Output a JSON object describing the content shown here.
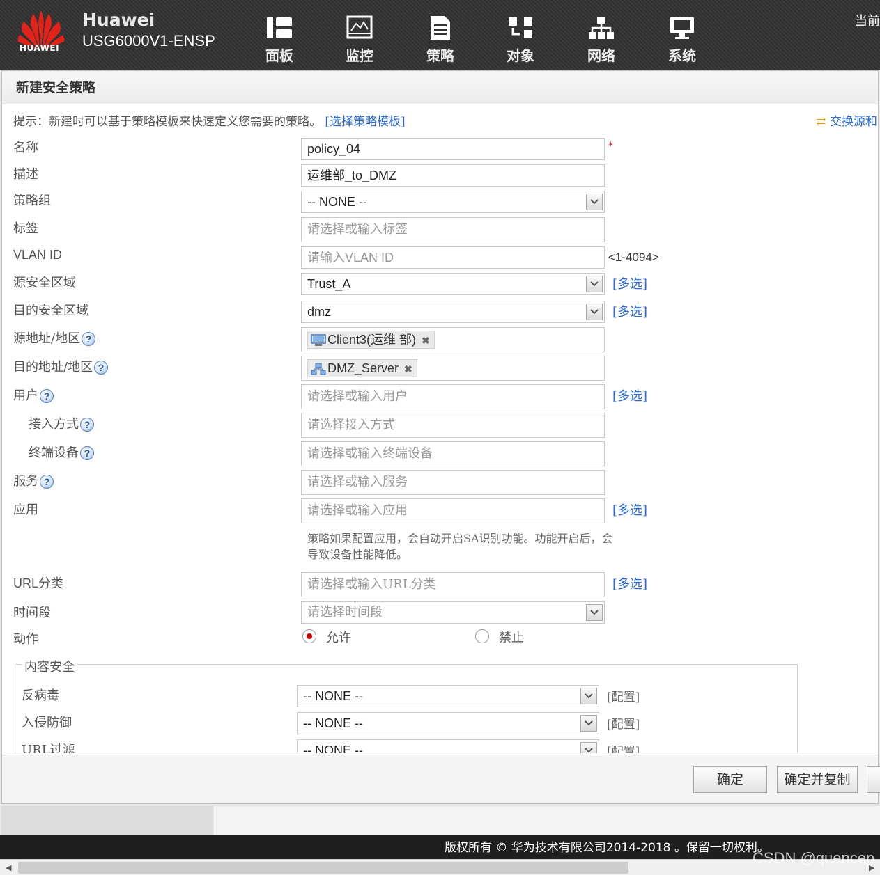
{
  "header": {
    "logo_text": "HUAWEI",
    "brand": "Huawei",
    "model": "USG6000V1-ENSP",
    "current_user_prefix": "当前",
    "nav": [
      {
        "label": "面板",
        "icon": "dashboard-icon"
      },
      {
        "label": "监控",
        "icon": "monitor-icon"
      },
      {
        "label": "策略",
        "icon": "policy-icon"
      },
      {
        "label": "对象",
        "icon": "object-icon"
      },
      {
        "label": "网络",
        "icon": "network-icon"
      },
      {
        "label": "系统",
        "icon": "system-icon"
      }
    ]
  },
  "dialog": {
    "title": "新建安全策略",
    "tip_text": "提示：新建时可以基于策略模板来快速定义您需要的策略。",
    "tip_link": "[选择策略模板]",
    "swap_link": "交换源和",
    "fields": {
      "name": {
        "label": "名称",
        "value": "policy_04"
      },
      "description": {
        "label": "描述",
        "value": "运维部_to_DMZ"
      },
      "policy_group": {
        "label": "策略组",
        "value": "-- NONE --"
      },
      "tag": {
        "label": "标签",
        "placeholder": "请选择或输入标签"
      },
      "vlan": {
        "label": "VLAN ID",
        "placeholder": "请输入VLAN ID",
        "range": "<1-4094>"
      },
      "src_zone": {
        "label": "源安全区域",
        "value": "Trust_A",
        "multi": "[多选]"
      },
      "dst_zone": {
        "label": "目的安全区域",
        "value": "dmz",
        "multi": "[多选]"
      },
      "src_addr": {
        "label": "源地址/地区",
        "token": "Client3(运维 部)"
      },
      "dst_addr": {
        "label": "目的地址/地区",
        "token": "DMZ_Server"
      },
      "user": {
        "label": "用户",
        "placeholder": "请选择或输入用户",
        "multi": "[多选]"
      },
      "access": {
        "label": "接入方式",
        "placeholder": "请选择接入方式"
      },
      "terminal": {
        "label": "终端设备",
        "placeholder": "请选择或输入终端设备"
      },
      "service": {
        "label": "服务",
        "placeholder": "请选择或输入服务"
      },
      "application": {
        "label": "应用",
        "placeholder": "请选择或输入应用",
        "multi": "[多选]"
      },
      "app_hint": "策略如果配置应用，会自动开启SA识别功能。功能开启后，会导致设备性能降低。",
      "url_category": {
        "label": "URL分类",
        "placeholder": "请选择或输入URL分类",
        "multi": "[多选]"
      },
      "time_range": {
        "label": "时间段",
        "placeholder": "请选择时间段"
      },
      "action": {
        "label": "动作",
        "permit": "允许",
        "deny": "禁止",
        "selected": "允许"
      }
    },
    "content_security": {
      "legend": "内容安全",
      "config_link": "[配置]",
      "items": [
        {
          "label": "反病毒",
          "value": "-- NONE --"
        },
        {
          "label": "入侵防御",
          "value": "-- NONE --"
        },
        {
          "label": "URL过滤",
          "value": "-- NONE --"
        }
      ]
    },
    "buttons": {
      "ok": "确定",
      "ok_copy": "确定并复制"
    }
  },
  "footer": {
    "copyright": "版权所有 © 华为技术有限公司2014-2018 。保留一切权利。",
    "watermark": "CSDN @quencep"
  },
  "colors": {
    "link": "#2a6bd6",
    "required": "#d0021b",
    "radio_on": "#cc0000",
    "topbar": "#333333"
  }
}
